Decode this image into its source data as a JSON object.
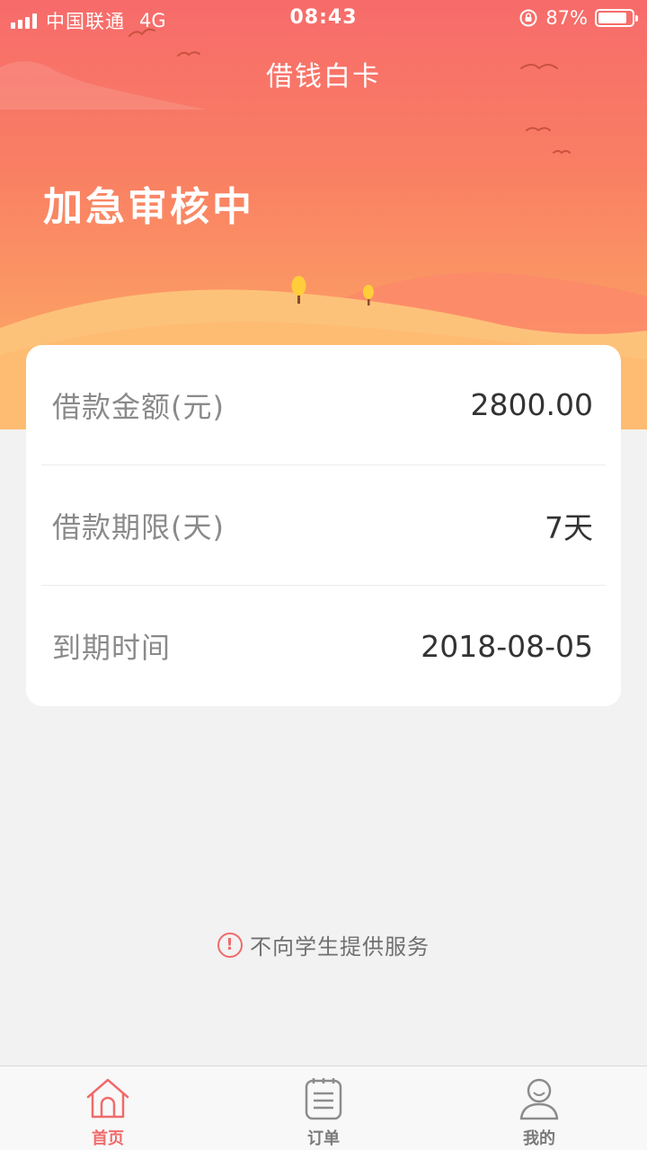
{
  "status_bar": {
    "carrier": "中国联通",
    "network": "4G",
    "time": "08:43",
    "battery": "87%",
    "battery_level": 0.87
  },
  "header": {
    "title": "借钱白卡",
    "status_heading": "加急审核中"
  },
  "loan_details": [
    {
      "label": "借款金额(元)",
      "value": "2800.00"
    },
    {
      "label": "借款期限(天)",
      "value": "7天"
    },
    {
      "label": "到期时间",
      "value": "2018-08-05"
    }
  ],
  "notice": {
    "icon": "!",
    "text": "不向学生提供服务"
  },
  "tab_bar": {
    "tabs": [
      {
        "label": "首页",
        "icon": "home-icon",
        "active": true
      },
      {
        "label": "订单",
        "icon": "order-list-icon",
        "active": false
      },
      {
        "label": "我的",
        "icon": "profile-icon",
        "active": false
      }
    ]
  },
  "colors": {
    "accent": "#f06b6b",
    "hero_top": "#f76b6b",
    "hero_bottom": "#fdb869"
  }
}
